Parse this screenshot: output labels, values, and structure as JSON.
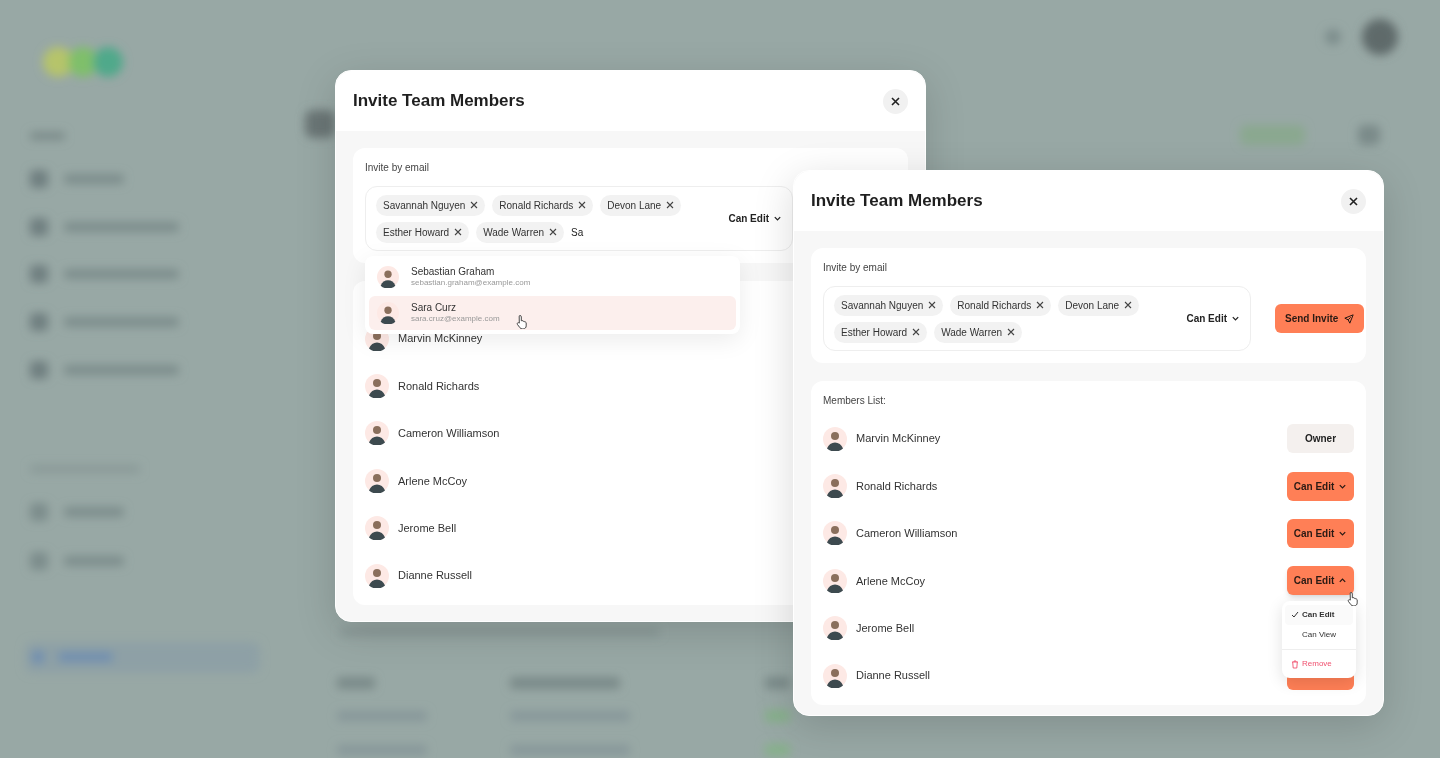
{
  "dialogs": [
    {
      "title": "Invite Team Members",
      "invite": {
        "label": "Invite by email",
        "tags": [
          "Savannah Nguyen",
          "Ronald Richards",
          "Devon Lane",
          "Esther Howard",
          "Wade Warren"
        ],
        "typed": "Sa",
        "permission": "Can Edit"
      },
      "suggestions": [
        {
          "name": "Sebastian Graham",
          "email": "sebastian.graham@example.com",
          "selected": false
        },
        {
          "name": "Sara Curz",
          "email": "sara.cruz@example.com",
          "selected": true
        }
      ],
      "members": [
        {
          "name": "Marvin McKinney"
        },
        {
          "name": "Ronald Richards"
        },
        {
          "name": "Cameron Williamson"
        },
        {
          "name": "Arlene McCoy"
        },
        {
          "name": "Jerome Bell"
        },
        {
          "name": "Dianne Russell"
        }
      ]
    },
    {
      "title": "Invite Team Members",
      "invite": {
        "label": "Invite by email",
        "tags": [
          "Savannah Nguyen",
          "Ronald Richards",
          "Devon Lane",
          "Esther Howard",
          "Wade Warren"
        ],
        "permission": "Can Edit",
        "send_button": "Send Invite"
      },
      "members_label": "Members List:",
      "members": [
        {
          "name": "Marvin McKinney",
          "role": {
            "kind": "owner",
            "label": "Owner"
          }
        },
        {
          "name": "Ronald Richards",
          "role": {
            "kind": "editable",
            "label": "Can Edit",
            "expanded": false
          }
        },
        {
          "name": "Cameron Williamson",
          "role": {
            "kind": "editable",
            "label": "Can Edit",
            "expanded": false
          }
        },
        {
          "name": "Arlene McCoy",
          "role": {
            "kind": "editable",
            "label": "Can Edit",
            "expanded": true
          }
        },
        {
          "name": "Jerome Bell"
        },
        {
          "name": "Dianne Russell",
          "role": {
            "kind": "editable"
          }
        }
      ],
      "role_menu": [
        {
          "kind": "option",
          "label": "Can Edit",
          "selected": true
        },
        {
          "kind": "option",
          "label": "Can View",
          "selected": false
        },
        {
          "kind": "danger",
          "label": "Remove"
        }
      ]
    }
  ]
}
